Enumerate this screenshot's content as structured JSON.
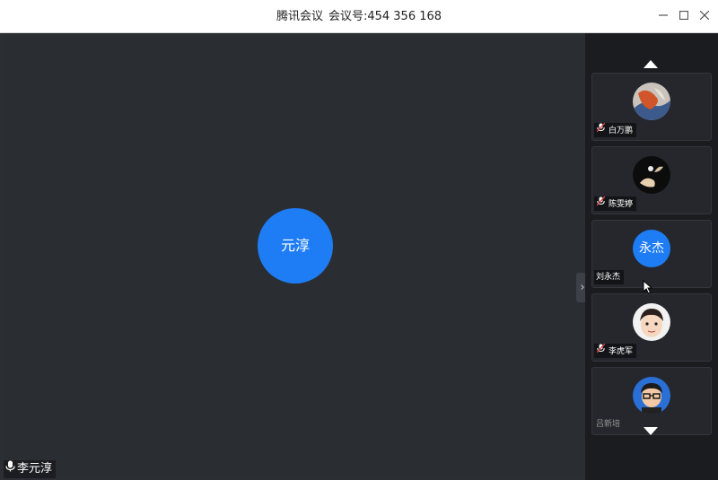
{
  "window": {
    "app_name": "腾讯会议",
    "meeting_id_label": "会议号:",
    "meeting_id": "454 356 168",
    "controls": {
      "minimize": "—",
      "maximize": "☐",
      "close": "✕"
    }
  },
  "main": {
    "speaker_initials": "元淳",
    "speaker_name": "李元淳",
    "avatar_color": "#1e7df5",
    "toggle_glyph": "›"
  },
  "sidebar": {
    "participants": [
      {
        "name": "白万鹏",
        "muted": true,
        "avatar": "abstract-painting"
      },
      {
        "name": "陈雯婷",
        "muted": true,
        "avatar": "dark-hand-photo"
      },
      {
        "name": "刘永杰",
        "muted": false,
        "initials": "永杰",
        "avatar": "initials"
      },
      {
        "name": "李虎军",
        "muted": true,
        "avatar": "cartoon-face"
      },
      {
        "name": "吕新培",
        "muted": false,
        "avatar": "cartoon-glasses"
      }
    ],
    "mute_icon": "mic-muted-icon",
    "scroll_icons": [
      "triangle-up-icon",
      "triangle-down-icon"
    ]
  }
}
